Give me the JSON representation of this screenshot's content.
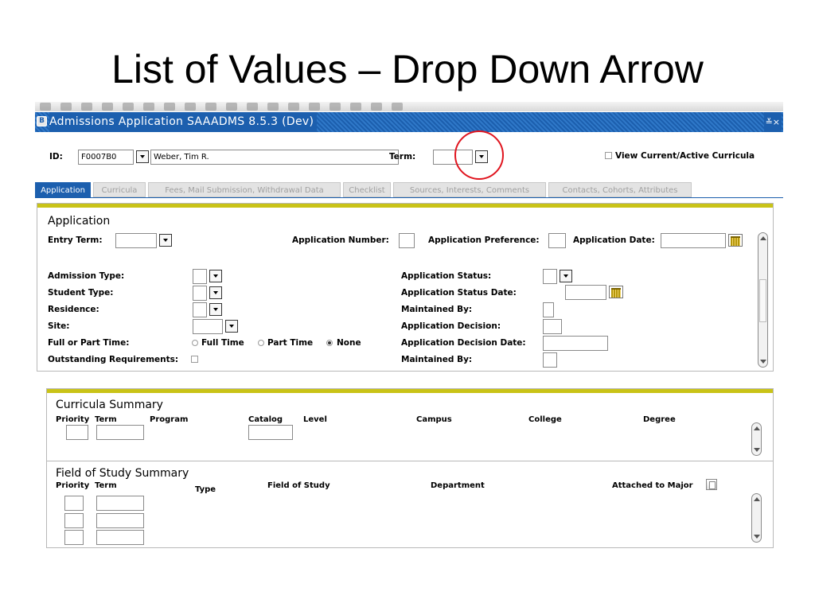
{
  "slide": {
    "title": "List of Values – Drop Down Arrow"
  },
  "window": {
    "title": "Admissions Application  SAAADMS  8.5.3  (Dev)",
    "controls": "≚×"
  },
  "key_block": {
    "id_label": "ID:",
    "id_value": "F0007B0",
    "name_value": "Weber, Tim R.",
    "term_label": "Term:",
    "term_value": "",
    "view_curricula_label": "View Current/Active Curricula"
  },
  "tabs": [
    {
      "label": "Application",
      "active": true
    },
    {
      "label": "Curricula",
      "active": false
    },
    {
      "label": "Fees, Mail Submission, Withdrawal Data",
      "active": false
    },
    {
      "label": "Checklist",
      "active": false
    },
    {
      "label": "Sources, Interests, Comments",
      "active": false
    },
    {
      "label": "Contacts, Cohorts, Attributes",
      "active": false
    }
  ],
  "application": {
    "title": "Application",
    "entry_term_label": "Entry Term:",
    "app_number_label": "Application Number:",
    "app_preference_label": "Application Preference:",
    "app_date_label": "Application Date:",
    "admission_type_label": "Admission Type:",
    "student_type_label": "Student Type:",
    "residence_label": "Residence:",
    "site_label": "Site:",
    "full_part_label": "Full or Part Time:",
    "full_time_label": "Full Time",
    "part_time_label": "Part Time",
    "none_label": "None",
    "outstanding_label": "Outstanding Requirements:",
    "app_status_label": "Application Status:",
    "app_status_date_label": "Application Status Date:",
    "maintained_by_label": "Maintained By:",
    "app_decision_label": "Application Decision:",
    "app_decision_date_label": "Application Decision Date:",
    "maintained_by_2_label": "Maintained By:",
    "selected_time": "none"
  },
  "curricula_summary": {
    "title": "Curricula Summary",
    "headers": {
      "priority": "Priority",
      "term": "Term",
      "program": "Program",
      "catalog": "Catalog",
      "level": "Level",
      "campus": "Campus",
      "college": "College",
      "degree": "Degree"
    }
  },
  "field_of_study": {
    "title": "Field of Study Summary",
    "headers": {
      "priority": "Priority",
      "term": "Term",
      "type": "Type",
      "field": "Field of Study",
      "department": "Department",
      "attached": "Attached to Major"
    }
  },
  "colors": {
    "accent_blue": "#1c5fae",
    "tab_bar": "#c9c317",
    "highlight": "#e0141e"
  }
}
